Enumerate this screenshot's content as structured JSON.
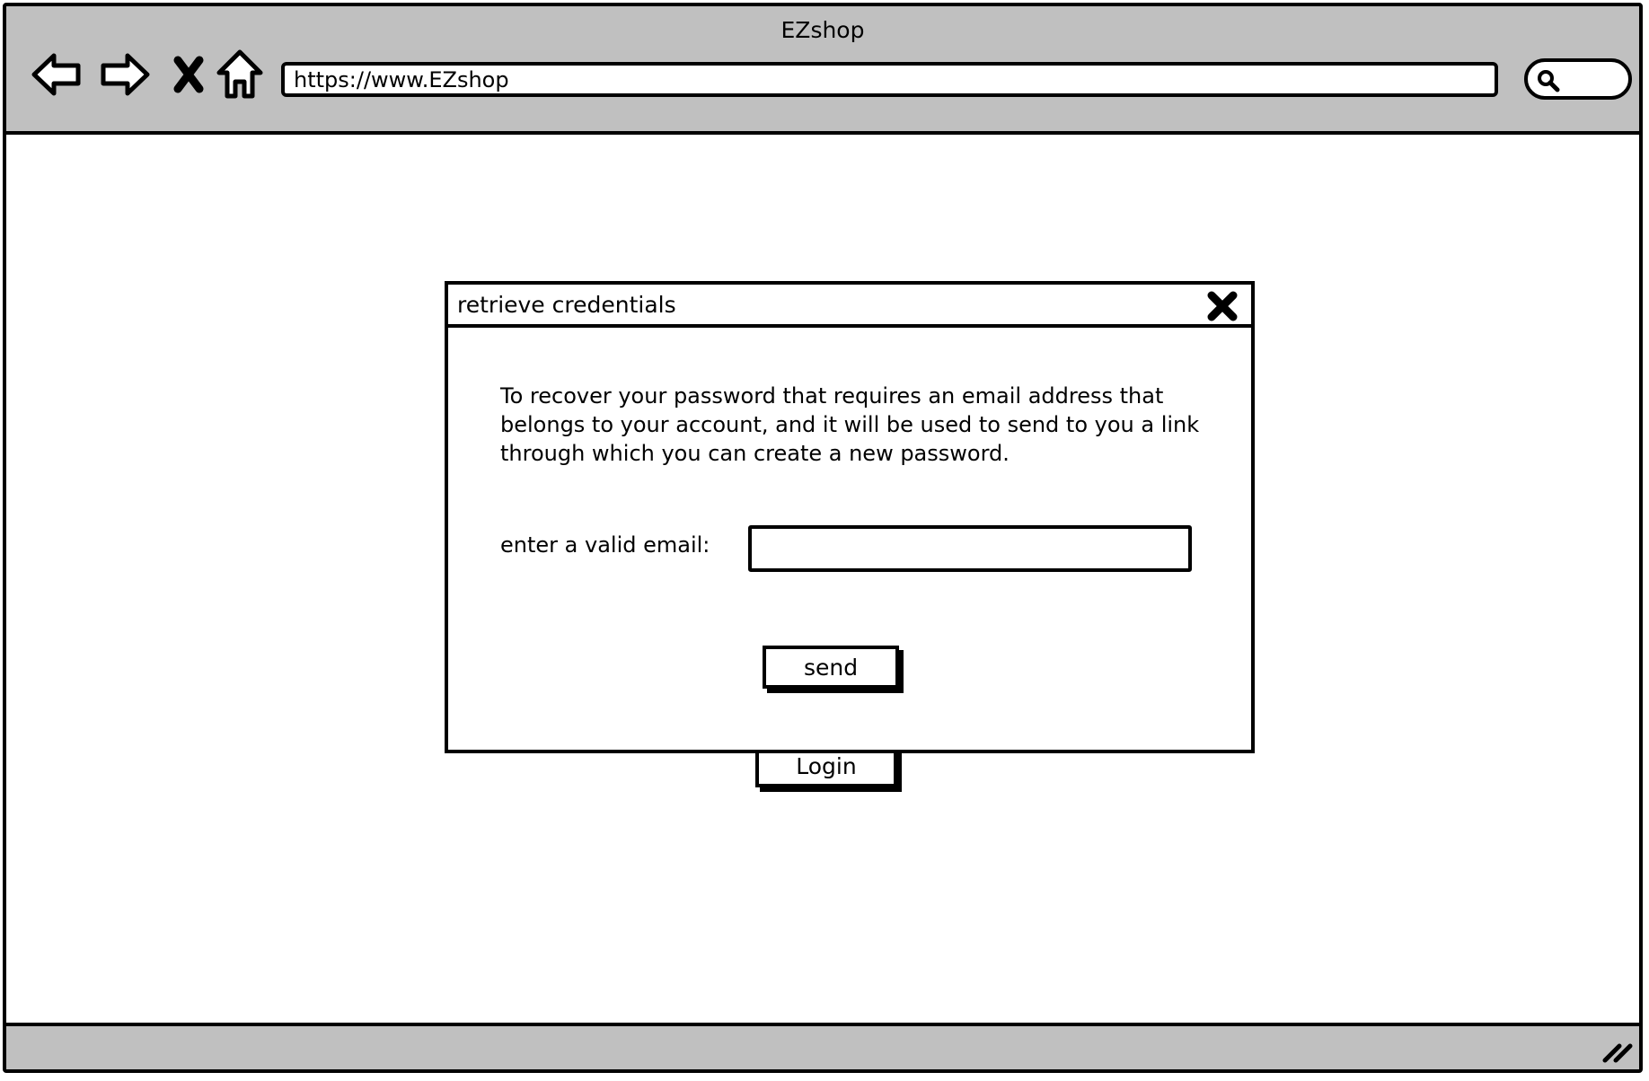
{
  "browser": {
    "window_title": "EZshop",
    "url": "https://www.EZshop",
    "nav_icons": [
      "back-arrow-icon",
      "forward-arrow-icon",
      "stop-icon",
      "home-icon"
    ],
    "search_icon": "search-icon"
  },
  "page": {
    "login_label": "Login"
  },
  "dialog": {
    "title": "retrieve credentials",
    "close_icon": "close-icon",
    "message": "To recover your password that requires an email address that belongs to your account, and it will be used to send to you a link through which you can create a new password.",
    "email_label": "enter a valid email:",
    "email_value": "",
    "send_label": "send"
  },
  "colors": {
    "chrome": "#c0c0c0",
    "border": "#000000",
    "background": "#ffffff"
  }
}
